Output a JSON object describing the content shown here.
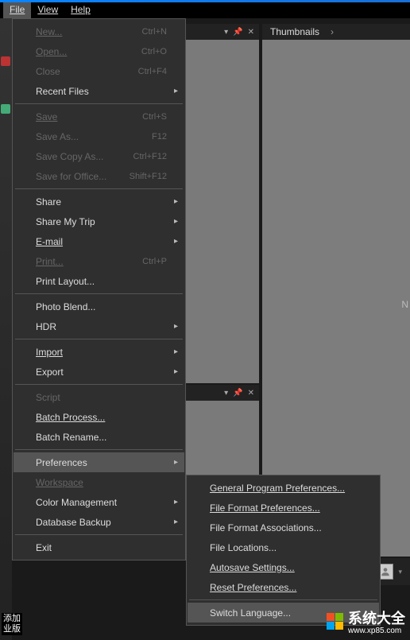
{
  "menubar": {
    "file": "File",
    "view": "View",
    "help": "Help"
  },
  "panels": {
    "thumbnails_label": "Thumbnails",
    "right_trunc": "N"
  },
  "file_menu": {
    "new": "New...",
    "new_sc": "Ctrl+N",
    "open": "Open...",
    "open_sc": "Ctrl+O",
    "close": "Close",
    "close_sc": "Ctrl+F4",
    "recent": "Recent Files",
    "save": "Save",
    "save_sc": "Ctrl+S",
    "save_as": "Save As...",
    "save_as_sc": "F12",
    "save_copy": "Save Copy As...",
    "save_copy_sc": "Ctrl+F12",
    "save_office": "Save for Office...",
    "save_office_sc": "Shift+F12",
    "share": "Share",
    "share_trip": "Share My Trip",
    "email": "E-mail",
    "print": "Print...",
    "print_sc": "Ctrl+P",
    "print_layout": "Print Layout...",
    "photo_blend": "Photo Blend...",
    "hdr": "HDR",
    "import": "Import",
    "export": "Export",
    "script": "Script",
    "batch_process": "Batch Process...",
    "batch_rename": "Batch Rename...",
    "preferences": "Preferences",
    "workspace": "Workspace",
    "color_mgmt": "Color Management",
    "db_backup": "Database Backup",
    "exit": "Exit"
  },
  "prefs_submenu": {
    "general": "General Program Preferences...",
    "file_format": "File Format Preferences...",
    "file_assoc": "File Format Associations...",
    "file_loc": "File Locations...",
    "autosave": "Autosave Settings...",
    "reset": "Reset Preferences...",
    "switch_lang": "Switch Language..."
  },
  "watermark": {
    "text": "系统大全",
    "url": "www.xp85.com"
  },
  "cn_badge": {
    "line1": "添加",
    "line2": "业版"
  }
}
